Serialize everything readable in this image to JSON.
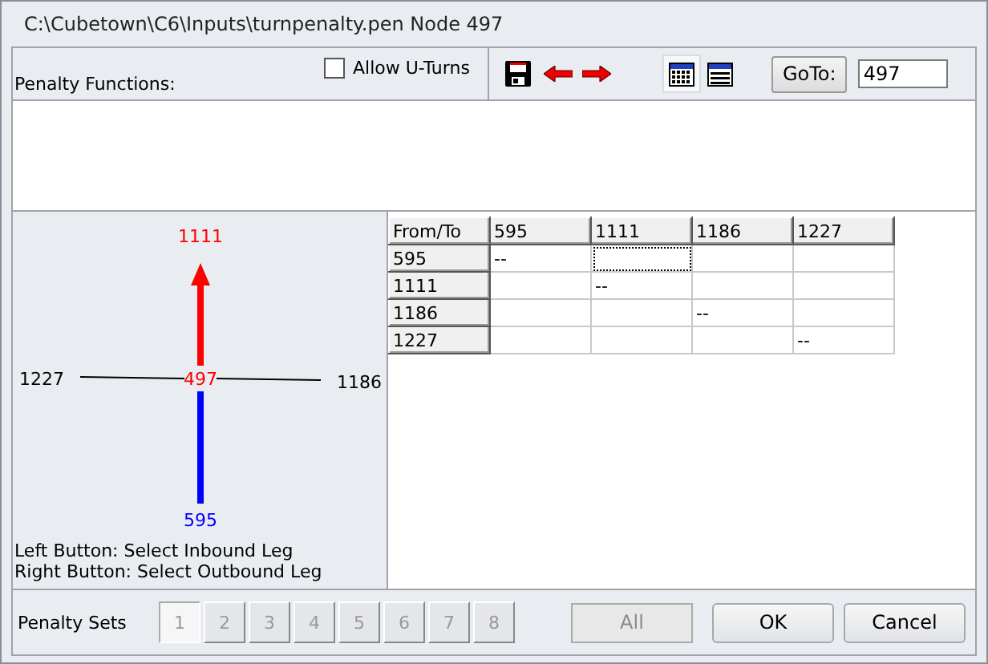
{
  "window": {
    "title": "C:\\Cubetown\\C6\\Inputs\\turnpenalty.pen  Node 497"
  },
  "toolbar": {
    "penalty_functions_label": "Penalty Functions:",
    "allow_uturns": {
      "label": "Allow U-Turns",
      "checked": false
    },
    "view_buttons": [
      {
        "kind": "grid",
        "selected": true
      },
      {
        "kind": "list",
        "selected": false
      }
    ],
    "goto": {
      "label": "GoTo:",
      "value": "497"
    }
  },
  "diagram": {
    "node": "497",
    "north_leg": {
      "label": "1111",
      "kind": "outbound"
    },
    "south_leg": {
      "label": "595",
      "kind": "inbound"
    },
    "west_leg": {
      "label": "1227",
      "kind": "plain"
    },
    "east_leg": {
      "label": "1186",
      "kind": "plain"
    },
    "hints": [
      "Left Button: Select Inbound Leg",
      "Right Button: Select Outbound Leg"
    ]
  },
  "table": {
    "columns": [
      "From/To",
      "595",
      "1111",
      "1186",
      "1227"
    ],
    "rows": [
      {
        "cells": [
          {
            "kind": "header",
            "text": "595",
            "focused": false
          },
          {
            "kind": "data",
            "text": "--",
            "focused": false
          },
          {
            "kind": "data",
            "focused": true
          },
          {
            "kind": "data",
            "focused": false
          },
          {
            "kind": "data",
            "focused": false
          }
        ]
      },
      {
        "cells": [
          {
            "kind": "header",
            "text": "1111",
            "focused": false
          },
          {
            "kind": "data",
            "focused": false
          },
          {
            "kind": "data",
            "text": "--",
            "focused": false
          },
          {
            "kind": "data",
            "focused": false
          },
          {
            "kind": "data",
            "focused": false
          }
        ]
      },
      {
        "cells": [
          {
            "kind": "header",
            "text": "1186",
            "focused": false
          },
          {
            "kind": "data",
            "focused": false
          },
          {
            "kind": "data",
            "focused": false
          },
          {
            "kind": "data",
            "text": "--",
            "focused": false
          },
          {
            "kind": "data",
            "focused": false
          }
        ]
      },
      {
        "cells": [
          {
            "kind": "header",
            "text": "1227",
            "focused": false
          },
          {
            "kind": "data",
            "focused": false
          },
          {
            "kind": "data",
            "focused": false
          },
          {
            "kind": "data",
            "focused": false
          },
          {
            "kind": "data",
            "text": "--",
            "focused": false
          }
        ]
      }
    ]
  },
  "penalty_sets": {
    "label": "Penalty Sets",
    "sets": [
      {
        "label": "1",
        "selected": true
      },
      {
        "label": "2",
        "selected": false
      },
      {
        "label": "3",
        "selected": false
      },
      {
        "label": "4",
        "selected": false
      },
      {
        "label": "5",
        "selected": false
      },
      {
        "label": "6",
        "selected": false
      },
      {
        "label": "7",
        "selected": false
      },
      {
        "label": "8",
        "selected": false
      }
    ]
  },
  "buttons": [
    {
      "label": "All",
      "disabled": true
    },
    {
      "label": "OK",
      "disabled": false
    },
    {
      "label": "Cancel",
      "disabled": false
    }
  ]
}
